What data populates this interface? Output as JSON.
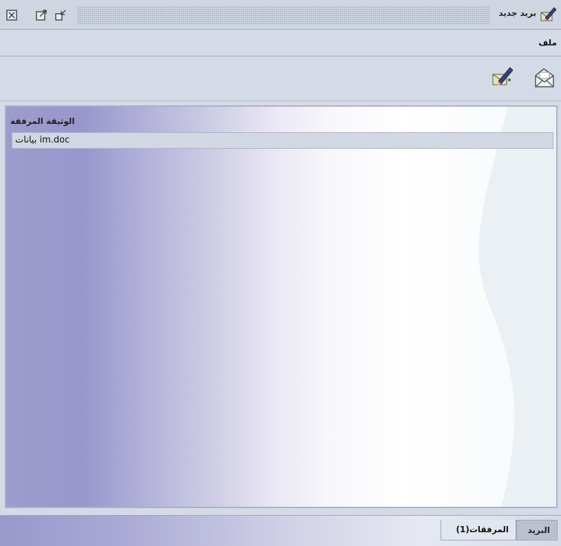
{
  "window": {
    "title": "بريد جديد",
    "title_icon": "new-mail-icon",
    "controls": [
      "restore-icon",
      "maximize-icon",
      "close-icon"
    ]
  },
  "menu": {
    "items": [
      "ملف"
    ]
  },
  "toolbar": {
    "buttons": [
      {
        "name": "send",
        "icon": "envelope-icon"
      },
      {
        "name": "compose",
        "icon": "new-mail-icon"
      }
    ]
  },
  "attachments": {
    "column_header": "الوثيقة المرفقة",
    "rows": [
      "بيانات im.doc"
    ]
  },
  "tabs": [
    {
      "label": "البريد",
      "active": false
    },
    {
      "label": "المرفقات(1)",
      "active": true
    }
  ],
  "colors": {
    "chrome": "#d5dbe6",
    "accent_purple": "#9896cc",
    "row_bg": "#d2d8e3"
  }
}
